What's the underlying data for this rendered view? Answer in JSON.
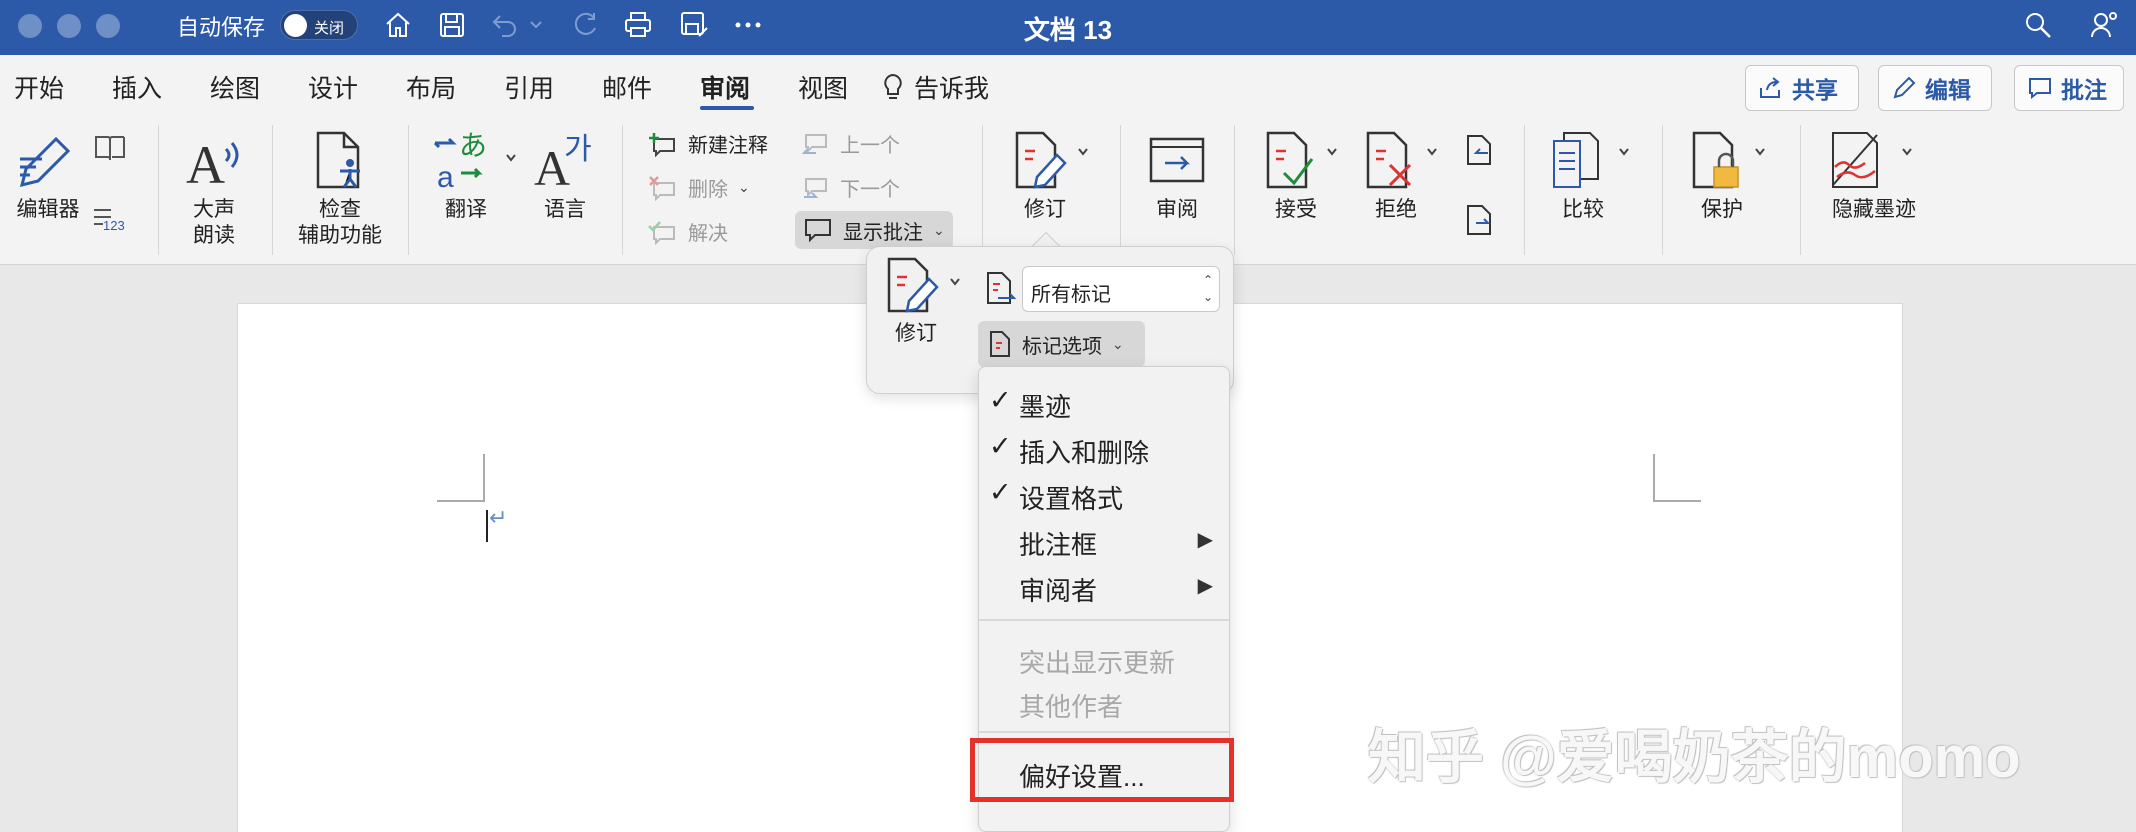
{
  "titlebar": {
    "autosave_label": "自动保存",
    "autosave_state": "关闭",
    "doc_title": "文档 13"
  },
  "tabs": [
    {
      "label": "开始"
    },
    {
      "label": "插入"
    },
    {
      "label": "绘图"
    },
    {
      "label": "设计"
    },
    {
      "label": "布局"
    },
    {
      "label": "引用"
    },
    {
      "label": "邮件"
    },
    {
      "label": "审阅"
    },
    {
      "label": "视图"
    }
  ],
  "tell_me": "告诉我",
  "header_buttons": {
    "share": "共享",
    "edit": "编辑",
    "comment": "批注"
  },
  "ribbon": {
    "editor": "编辑器",
    "read_aloud": [
      "大声",
      "朗读"
    ],
    "accessibility": [
      "检查",
      "辅助功能"
    ],
    "translate": "翻译",
    "language": "语言",
    "new_comment": "新建注释",
    "delete": "删除",
    "resolve": "解决",
    "previous": "上一个",
    "next": "下一个",
    "show_comments": "显示批注",
    "track_changes": "修订",
    "review": "审阅",
    "accept": "接受",
    "reject": "拒绝",
    "compare": "比较",
    "protect": "保护",
    "hide_ink": "隐藏墨迹"
  },
  "popover": {
    "track_changes": "修订",
    "markup_select": "所有标记",
    "markup_options": "标记选项"
  },
  "menu": {
    "items": [
      {
        "label": "墨迹",
        "checked": true
      },
      {
        "label": "插入和删除",
        "checked": true
      },
      {
        "label": "设置格式",
        "checked": true
      },
      {
        "label": "批注框",
        "submenu": true
      },
      {
        "label": "审阅者",
        "submenu": true
      }
    ],
    "disabled_items": [
      {
        "label": "突出显示更新"
      },
      {
        "label": "其他作者"
      }
    ],
    "preferences": "偏好设置..."
  },
  "watermark": "知乎 @爱喝奶茶的momo",
  "colors": {
    "titlebar": "#2c5aa9",
    "accent": "#2c5aa9",
    "highlight_box": "#e3322b"
  }
}
